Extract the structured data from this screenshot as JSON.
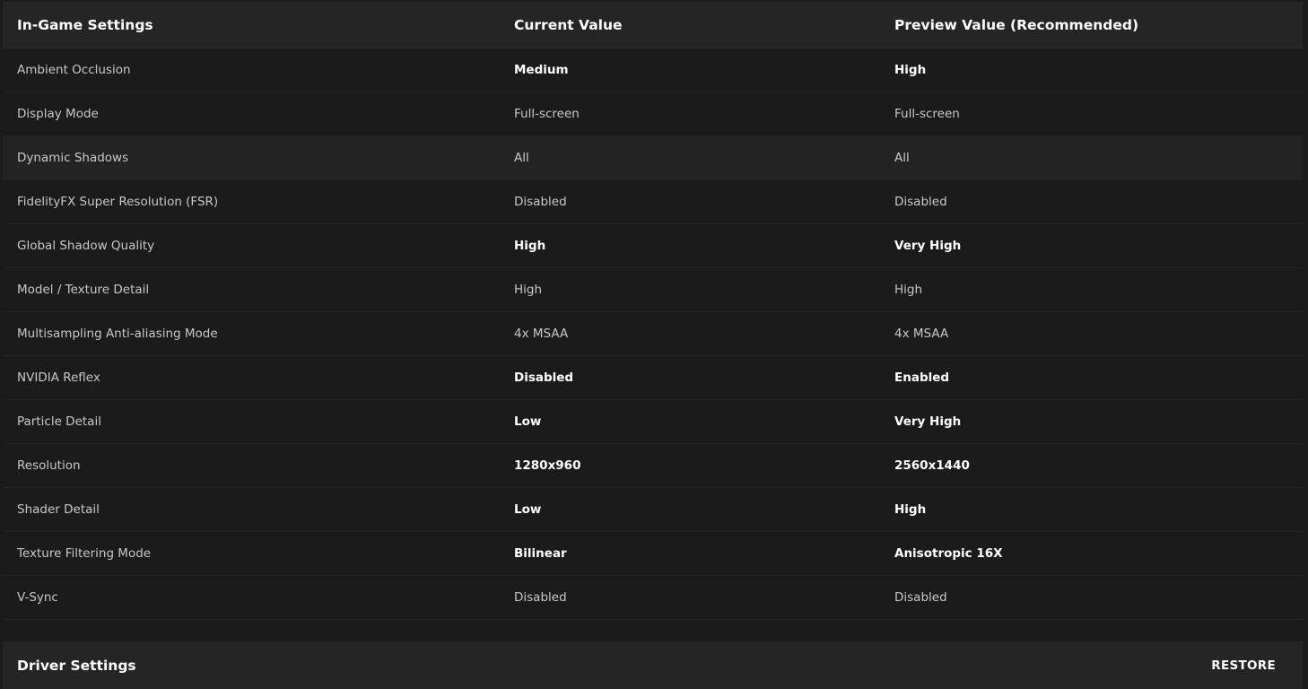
{
  "ingame": {
    "headers": {
      "setting": "In-Game Settings",
      "current": "Current Value",
      "preview": "Preview Value (Recommended)"
    },
    "rows": [
      {
        "name": "Ambient Occlusion",
        "current": "Medium",
        "preview": "High",
        "changed": true
      },
      {
        "name": "Display Mode",
        "current": "Full-screen",
        "preview": "Full-screen",
        "changed": false
      },
      {
        "name": "Dynamic Shadows",
        "current": "All",
        "preview": "All",
        "changed": false
      },
      {
        "name": "FidelityFX Super Resolution (FSR)",
        "current": "Disabled",
        "preview": "Disabled",
        "changed": false
      },
      {
        "name": "Global Shadow Quality",
        "current": "High",
        "preview": "Very High",
        "changed": true
      },
      {
        "name": "Model / Texture Detail",
        "current": "High",
        "preview": "High",
        "changed": false
      },
      {
        "name": "Multisampling Anti-aliasing Mode",
        "current": "4x MSAA",
        "preview": "4x MSAA",
        "changed": false
      },
      {
        "name": "NVIDIA Reflex",
        "current": "Disabled",
        "preview": "Enabled",
        "changed": true
      },
      {
        "name": "Particle Detail",
        "current": "Low",
        "preview": "Very High",
        "changed": true
      },
      {
        "name": "Resolution",
        "current": "1280x960",
        "preview": "2560x1440",
        "changed": true
      },
      {
        "name": "Shader Detail",
        "current": "Low",
        "preview": "High",
        "changed": true
      },
      {
        "name": "Texture Filtering Mode",
        "current": "Bilinear",
        "preview": "Anisotropic 16X",
        "changed": true
      },
      {
        "name": "V-Sync",
        "current": "Disabled",
        "preview": "Disabled",
        "changed": false
      }
    ]
  },
  "driver": {
    "title": "Driver Settings",
    "restore_label": "RESTORE"
  },
  "colors": {
    "background": "#1b1b1b",
    "header_background": "#252525",
    "highlight_text": "#ffffff",
    "normal_text": "#c8c8c8"
  }
}
